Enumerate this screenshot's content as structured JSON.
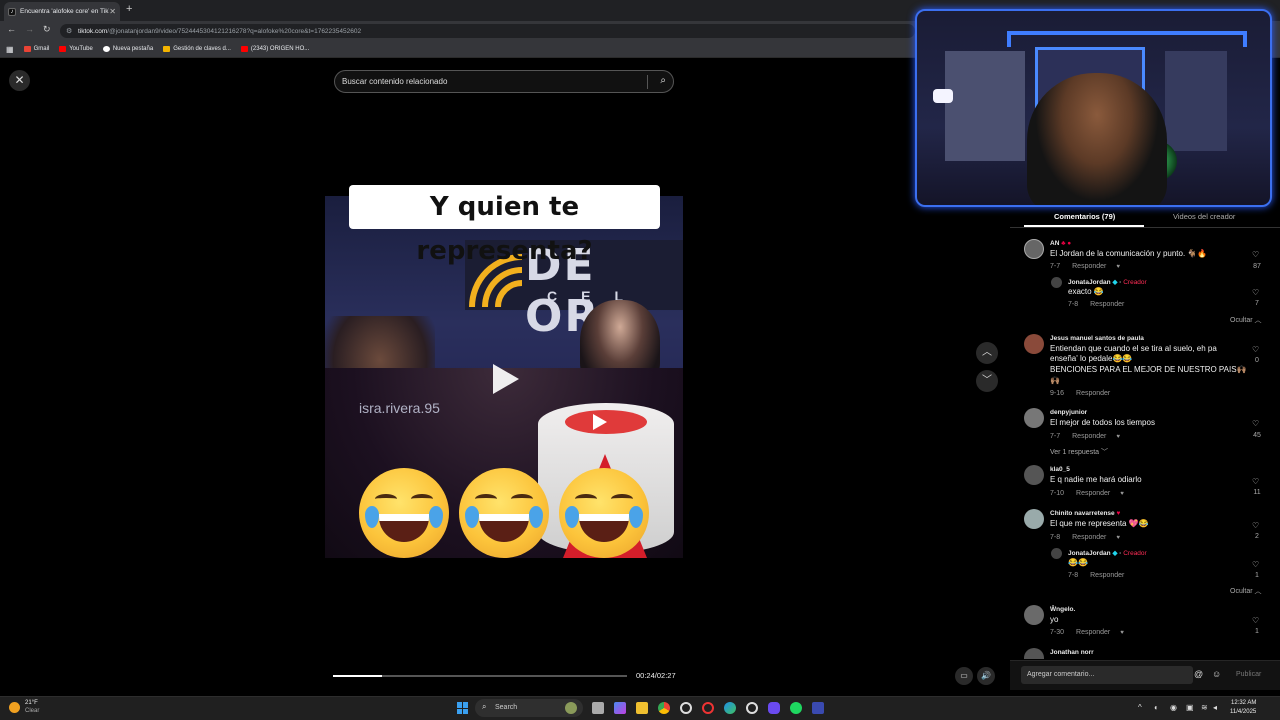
{
  "browser": {
    "tab_title": "Encuentra 'alofoke core' en TikTok",
    "new_tab_symbol": "+",
    "url_host": "tiktok.com",
    "url_path": "/@jonatanjordan9/video/7524445304121216278?q=alofoke%20core&t=1762235452602",
    "bookmarks": [
      {
        "label": "Gmail",
        "color": "#ea4335"
      },
      {
        "label": "YouTube",
        "color": "#ff0000"
      },
      {
        "label": "Nueva pestaña",
        "color": "#ffffff"
      },
      {
        "label": "Gestión de claves d...",
        "color": "#f4b400"
      },
      {
        "label": "(2343) ORIGEN HO...",
        "color": "#ff0000"
      }
    ]
  },
  "search": {
    "placeholder": "Buscar contenido relacionado"
  },
  "video": {
    "caption": "Y quien te representa?",
    "studio_logo": "DE OR",
    "studio_logo_sub": "CEL",
    "watermark": "isra.rivera.95",
    "time": "00:24/02:27",
    "progress": 0.166
  },
  "comments_panel": {
    "tab_comments": "Comentarios (79)",
    "tab_videos": "Videos del creador",
    "reply_label": "Responder",
    "hide_label": "Ocultar",
    "creator_label": "Creador",
    "comments": [
      {
        "user": "AN",
        "text": "El Jordan de la comunicación y punto. 🐐🔥",
        "date": "7-7",
        "likes": "87",
        "avatar": "#666"
      },
      {
        "user": "JonataJordan",
        "text": "exacto 😂",
        "date": "7-8",
        "likes": "7",
        "avatar": "#444"
      },
      {
        "user": "Jesus manuel santos de paula",
        "text1": "Entiendan que cuando el se tira al suelo, eh pa",
        "text2": "enseña' lo pedale😂😂",
        "text3": "BENCIONES PARA EL MEJOR DE NUESTRO PAIS🙌🏽",
        "text4": "🙌🏽",
        "date": "9-16",
        "likes": "0",
        "avatar": "#8a4a3a"
      },
      {
        "user": "denpyjunior",
        "text": "El mejor de todos los tiempos",
        "date": "7-7",
        "likes": "45",
        "avatar": "#777",
        "more": "Ver 1 respuesta"
      },
      {
        "user": "kla0_5",
        "text": "E q nadie me hará odiarlo",
        "date": "7-10",
        "likes": "11",
        "avatar": "#555"
      },
      {
        "user": "Chinito navarretense",
        "text": "El que me representa 💖😂",
        "date": "7-8",
        "likes": "2",
        "avatar": "#9aa"
      },
      {
        "user": "JonataJordan",
        "text": "😂😂",
        "date": "7-8",
        "likes": "1",
        "avatar": "#444"
      },
      {
        "user": "Ŵngelo.",
        "text": "yo",
        "date": "7-30",
        "likes": "1",
        "avatar": "#6a6a6a"
      },
      {
        "user": "Jonathan norr",
        "avatar": "#555"
      }
    ],
    "input_placeholder": "Agregar comentario...",
    "publish": "Publicar"
  },
  "taskbar": {
    "temp": "21°F",
    "cond": "Clear",
    "search": "Search",
    "time": "12:32 AM",
    "date": "11/4/2025"
  }
}
